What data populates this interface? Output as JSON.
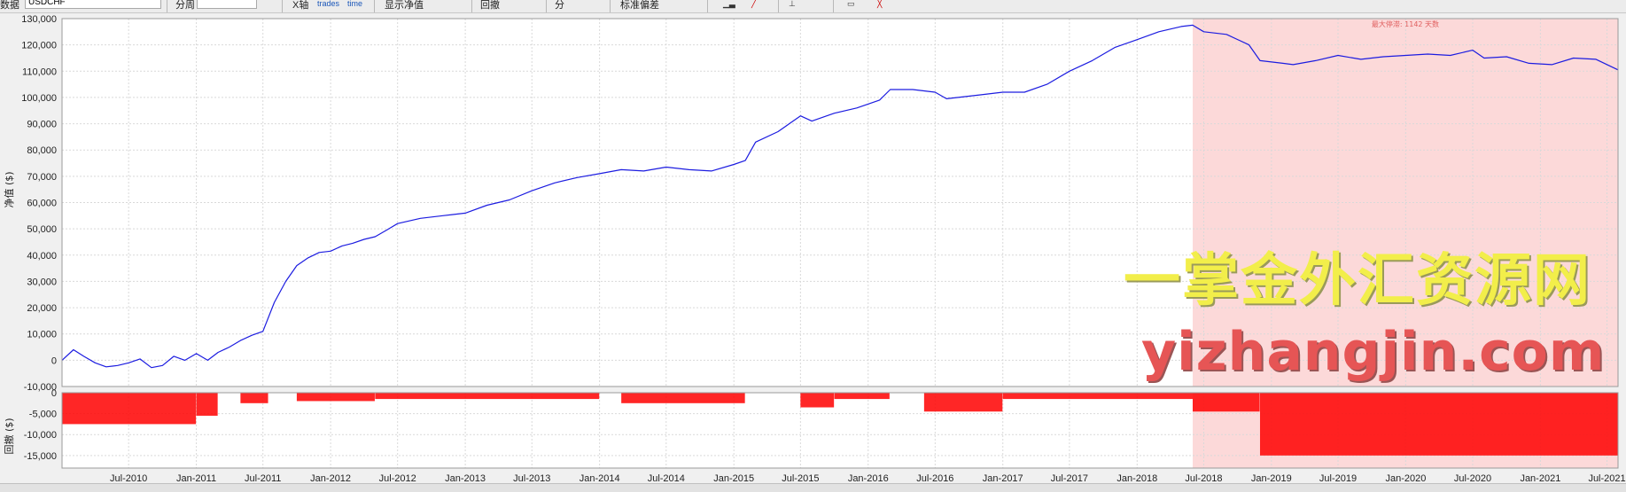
{
  "toolbar": {
    "symbol": "USDCHF",
    "items": [
      "分周",
      "X轴",
      "显示净值",
      "回撤",
      "分",
      "标准偏差"
    ],
    "trades_label": "trades",
    "time_label": "time"
  },
  "chart_data": {
    "type": "line",
    "y_axis_label": "净值 ($)",
    "drawdown_axis_label": "回撤 ($)",
    "ylim": [
      -10000,
      130000
    ],
    "yticks": [
      -10000,
      0,
      10000,
      20000,
      30000,
      40000,
      50000,
      60000,
      70000,
      80000,
      90000,
      100000,
      110000,
      120000,
      130000
    ],
    "ytick_labels": [
      "-10,000",
      "0",
      "10,000",
      "20,000",
      "30,000",
      "40,000",
      "50,000",
      "60,000",
      "70,000",
      "80,000",
      "90,000",
      "100,000",
      "110,000",
      "120,000",
      "130,000"
    ],
    "dd_ylim": [
      -18000,
      0
    ],
    "dd_yticks": [
      0,
      -5000,
      -10000,
      -15000
    ],
    "dd_ytick_labels": [
      "0",
      "-5,000",
      "-10,000",
      "-15,000"
    ],
    "xlim": [
      "2010-01-01",
      "2021-07-31"
    ],
    "xticks": [
      "2010-07-01",
      "2011-01-01",
      "2011-07-01",
      "2012-01-01",
      "2012-07-01",
      "2013-01-01",
      "2013-07-01",
      "2014-01-01",
      "2014-07-01",
      "2015-01-01",
      "2015-07-01",
      "2016-01-01",
      "2016-07-01",
      "2017-01-01",
      "2017-07-01",
      "2018-01-01",
      "2018-07-01",
      "2019-01-01",
      "2019-07-01",
      "2020-01-01",
      "2020-07-01",
      "2021-01-01",
      "2021-07-01"
    ],
    "xtick_labels": [
      "Jul-2010",
      "Jan-2011",
      "Jul-2011",
      "Jan-2012",
      "Jul-2012",
      "Jan-2013",
      "Jul-2013",
      "Jan-2014",
      "Jul-2014",
      "Jan-2015",
      "Jul-2015",
      "Jan-2016",
      "Jul-2016",
      "Jan-2017",
      "Jul-2017",
      "Jan-2018",
      "Jul-2018",
      "Jan-2019",
      "Jul-2019",
      "Jan-2020",
      "Jul-2020",
      "Jan-2021",
      "Jul-2021"
    ],
    "grid": true,
    "series": [
      {
        "color": "#1c1ce0",
        "points": [
          [
            "2010-01-01",
            0
          ],
          [
            "2010-02-01",
            4000
          ],
          [
            "2010-03-01",
            1500
          ],
          [
            "2010-04-01",
            -1000
          ],
          [
            "2010-05-01",
            -2500
          ],
          [
            "2010-06-01",
            -2000
          ],
          [
            "2010-07-01",
            -1000
          ],
          [
            "2010-08-01",
            500
          ],
          [
            "2010-09-01",
            -2800
          ],
          [
            "2010-10-01",
            -2000
          ],
          [
            "2010-11-01",
            1500
          ],
          [
            "2010-12-01",
            0
          ],
          [
            "2011-01-01",
            2500
          ],
          [
            "2011-02-01",
            0
          ],
          [
            "2011-03-01",
            3000
          ],
          [
            "2011-04-01",
            5000
          ],
          [
            "2011-05-01",
            7500
          ],
          [
            "2011-06-01",
            9500
          ],
          [
            "2011-07-01",
            11000
          ],
          [
            "2011-08-01",
            22000
          ],
          [
            "2011-09-01",
            30000
          ],
          [
            "2011-10-01",
            36000
          ],
          [
            "2011-11-01",
            39000
          ],
          [
            "2011-12-01",
            41000
          ],
          [
            "2012-01-01",
            41500
          ],
          [
            "2012-02-01",
            43500
          ],
          [
            "2012-03-01",
            44500
          ],
          [
            "2012-04-01",
            46000
          ],
          [
            "2012-05-01",
            47000
          ],
          [
            "2012-06-01",
            49500
          ],
          [
            "2012-07-01",
            52000
          ],
          [
            "2012-09-01",
            54000
          ],
          [
            "2012-11-01",
            55000
          ],
          [
            "2013-01-01",
            56000
          ],
          [
            "2013-03-01",
            59000
          ],
          [
            "2013-05-01",
            61000
          ],
          [
            "2013-07-01",
            64500
          ],
          [
            "2013-09-01",
            67500
          ],
          [
            "2013-11-01",
            69500
          ],
          [
            "2014-01-01",
            71000
          ],
          [
            "2014-03-01",
            72500
          ],
          [
            "2014-05-01",
            72000
          ],
          [
            "2014-07-01",
            73500
          ],
          [
            "2014-09-01",
            72500
          ],
          [
            "2014-11-01",
            72000
          ],
          [
            "2015-01-01",
            74500
          ],
          [
            "2015-02-01",
            76000
          ],
          [
            "2015-03-01",
            83000
          ],
          [
            "2015-05-01",
            87000
          ],
          [
            "2015-07-01",
            93000
          ],
          [
            "2015-08-01",
            91000
          ],
          [
            "2015-10-01",
            94000
          ],
          [
            "2015-12-01",
            96000
          ],
          [
            "2016-02-01",
            99000
          ],
          [
            "2016-03-01",
            103000
          ],
          [
            "2016-05-01",
            103000
          ],
          [
            "2016-07-01",
            102000
          ],
          [
            "2016-08-01",
            99500
          ],
          [
            "2016-11-01",
            101000
          ],
          [
            "2017-01-01",
            102000
          ],
          [
            "2017-03-01",
            102000
          ],
          [
            "2017-05-01",
            105000
          ],
          [
            "2017-07-01",
            110000
          ],
          [
            "2017-09-01",
            114000
          ],
          [
            "2017-11-01",
            119000
          ],
          [
            "2018-01-01",
            122000
          ],
          [
            "2018-03-01",
            125000
          ],
          [
            "2018-05-01",
            127000
          ],
          [
            "2018-06-01",
            127500
          ],
          [
            "2018-07-01",
            125000
          ],
          [
            "2018-09-01",
            124000
          ],
          [
            "2018-11-01",
            120000
          ],
          [
            "2018-12-01",
            114000
          ],
          [
            "2019-02-01",
            113000
          ],
          [
            "2019-03-01",
            112500
          ],
          [
            "2019-05-01",
            114000
          ],
          [
            "2019-07-01",
            116000
          ],
          [
            "2019-09-01",
            114500
          ],
          [
            "2019-11-01",
            115500
          ],
          [
            "2020-01-01",
            116000
          ],
          [
            "2020-03-01",
            116500
          ],
          [
            "2020-05-01",
            116000
          ],
          [
            "2020-07-01",
            118000
          ],
          [
            "2020-08-01",
            115000
          ],
          [
            "2020-10-01",
            115500
          ],
          [
            "2020-12-01",
            113000
          ],
          [
            "2021-02-01",
            112500
          ],
          [
            "2021-04-01",
            115000
          ],
          [
            "2021-06-01",
            114500
          ],
          [
            "2021-07-31",
            110500
          ]
        ]
      }
    ],
    "max_drawdown_period": {
      "start": "2018-06-01",
      "end": "2021-07-31",
      "label": "最大停滞: 1142 天数",
      "color": "#fcd9d9"
    },
    "drawdown_color": "#ff0000",
    "drawdown_segments": [
      [
        "2010-01-01",
        "2010-12-31",
        -7500
      ],
      [
        "2011-01-01",
        "2011-02-28",
        -5500
      ],
      [
        "2011-05-01",
        "2011-07-15",
        -2500
      ],
      [
        "2011-10-01",
        "2012-04-30",
        -2000
      ],
      [
        "2012-05-01",
        "2013-12-31",
        -1500
      ],
      [
        "2014-03-01",
        "2015-01-31",
        -2500
      ],
      [
        "2015-07-01",
        "2015-09-30",
        -3500
      ],
      [
        "2015-10-01",
        "2016-02-28",
        -1500
      ],
      [
        "2016-06-01",
        "2016-12-31",
        -4500
      ],
      [
        "2017-01-01",
        "2018-06-01",
        -1500
      ],
      [
        "2018-06-01",
        "2018-11-30",
        -4500
      ],
      [
        "2018-12-01",
        "2021-07-31",
        -15000
      ]
    ]
  },
  "watermark": {
    "line1": "一掌金外汇资源网",
    "line2": "yizhangjin.com"
  }
}
